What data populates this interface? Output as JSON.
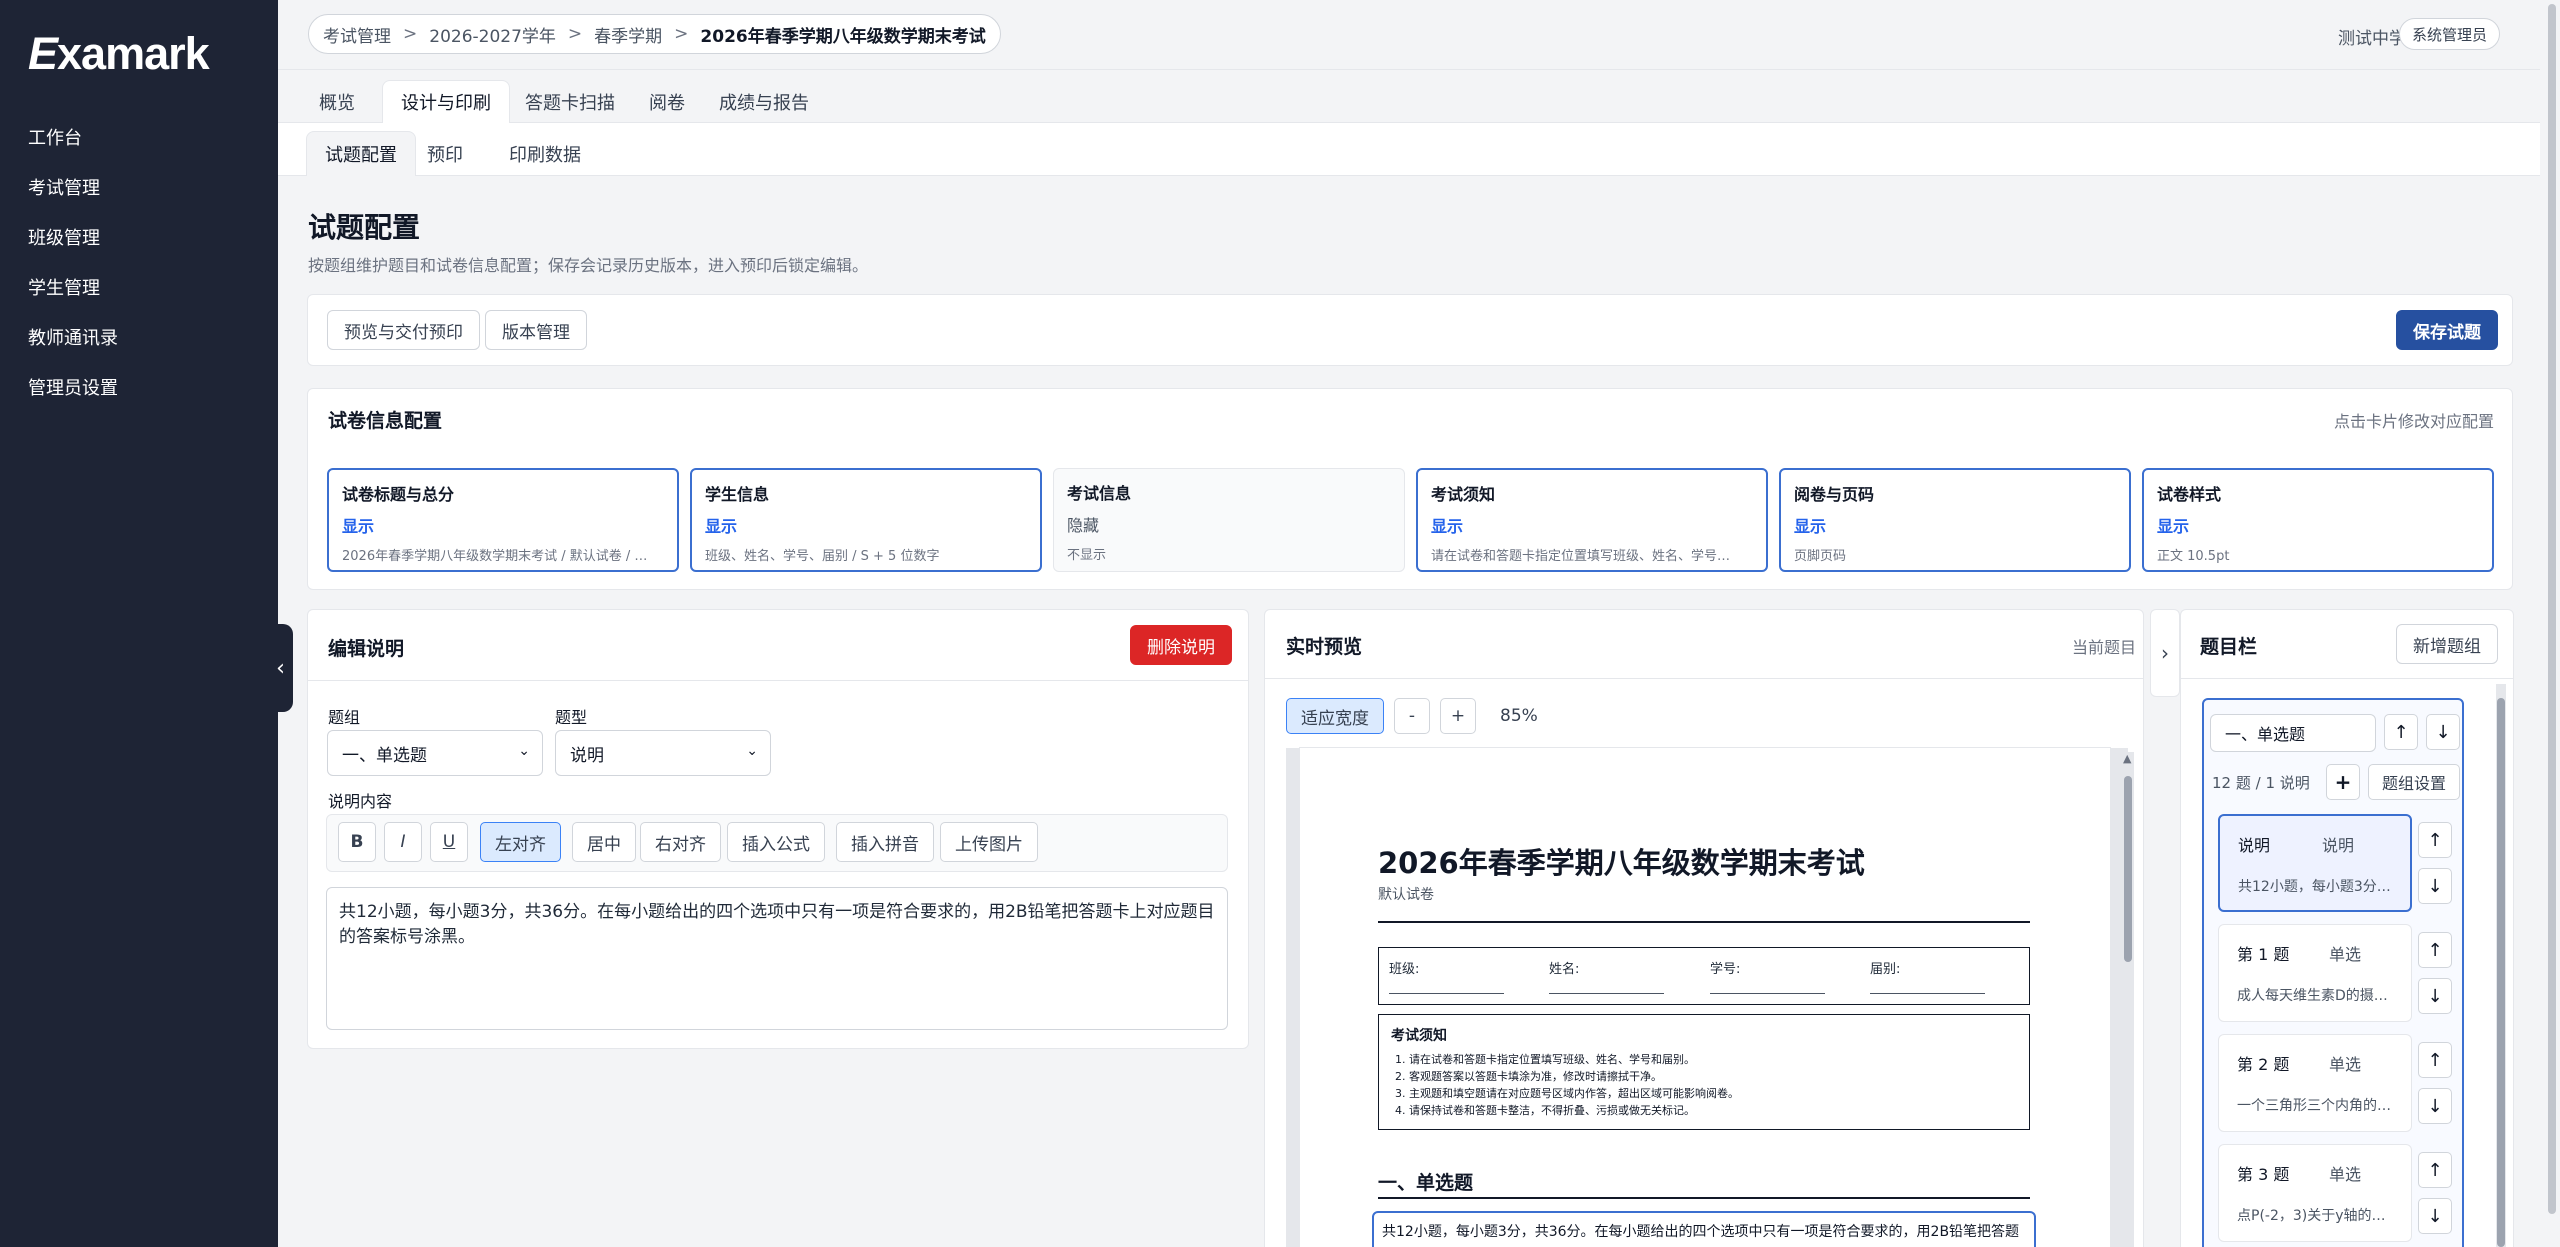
{
  "app": {
    "logo_prefix": "E",
    "logo_rest": "xamark"
  },
  "sidebar": {
    "items": [
      {
        "label": "工作台"
      },
      {
        "label": "考试管理"
      },
      {
        "label": "班级管理"
      },
      {
        "label": "学生管理"
      },
      {
        "label": "教师通讯录"
      },
      {
        "label": "管理员设置"
      }
    ]
  },
  "breadcrumb": [
    "考试管理",
    "2026-2027学年",
    "春季学期",
    "2026年春季学期八年级数学期末考试"
  ],
  "breadcrumb_sep": ">",
  "header": {
    "school": "测试中学",
    "role": "系统管理员"
  },
  "tabs": [
    "概览",
    "设计与印刷",
    "答题卡扫描",
    "阅卷",
    "成绩与报告"
  ],
  "subtabs": [
    "试题配置",
    "预印",
    "印刷数据"
  ],
  "page": {
    "title": "试题配置",
    "description": "按题组维护题目和试卷信息配置；保存会记录历史版本，进入预印后锁定编辑。"
  },
  "toolbar": {
    "preview_delivery": "预览与交付预印",
    "version_mgmt": "版本管理",
    "save": "保存试题"
  },
  "exam_info": {
    "title": "试卷信息配置",
    "hint": "点击卡片修改对应配置",
    "cards": [
      {
        "title": "试卷标题与总分",
        "status": "显示",
        "desc": "2026年春季学期八年级数学期末考试 / 默认试卷 / …"
      },
      {
        "title": "学生信息",
        "status": "显示",
        "desc": "班级、姓名、学号、届别 / S + 5 位数字"
      },
      {
        "title": "考试信息",
        "status": "隐藏",
        "desc": "不显示"
      },
      {
        "title": "考试须知",
        "status": "显示",
        "desc": "请在试卷和答题卡指定位置填写班级、姓名、学号…"
      },
      {
        "title": "阅卷与页码",
        "status": "显示",
        "desc": "页脚页码"
      },
      {
        "title": "试卷样式",
        "status": "显示",
        "desc": "正文 10.5pt"
      }
    ]
  },
  "edit_panel": {
    "title": "编辑说明",
    "delete_label": "删除说明",
    "group_label": "题组",
    "group_value": "一、单选题",
    "type_label": "题型",
    "type_value": "说明",
    "content_label": "说明内容",
    "format_buttons": [
      "B",
      "I",
      "U",
      "左对齐",
      "居中",
      "右对齐",
      "插入公式",
      "插入拼音",
      "上传图片"
    ],
    "content": "共12小题，每小题3分，共36分。在每小题给出的四个选项中只有一项是符合要求的，用2B铅笔把答题卡上对应题目的答案标号涂黑。"
  },
  "preview": {
    "title": "实时预览",
    "hint": "当前题目",
    "fit_width": "适应宽度",
    "zoom_out": "-",
    "zoom_in": "+",
    "zoom_level": "85%",
    "paper": {
      "title": "2026年春季学期八年级数学期末考试",
      "subtitle": "默认试卷",
      "fields": [
        "班级:",
        "姓名:",
        "学号:",
        "届别:"
      ],
      "notice_title": "考试须知",
      "notices": [
        "请在试卷和答题卡指定位置填写班级、姓名、学号和届别。",
        "客观题答案以答题卡填涂为准，修改时请擦拭干净。",
        "主观题和填空题请在对应题号区域内作答，超出区域可能影响阅卷。",
        "请保持试卷和答题卡整洁，不得折叠、污损或做无关标记。"
      ],
      "section_title": "一、单选题",
      "section_desc": "共12小题，每小题3分，共36分。在每小题给出的四个选项中只有一项是符合要求的，用2B铅笔把答题"
    }
  },
  "question_panel": {
    "title": "题目栏",
    "add_group": "新增题组",
    "group_name": "一、单选题",
    "group_count": "12 题 / 1 说明",
    "group_settings": "题组设置",
    "add_symbol": "+",
    "up_symbol": "↑",
    "down_symbol": "↓",
    "items": [
      {
        "head": "说明",
        "type": "说明",
        "desc": "共12小题，每小题3分…"
      },
      {
        "head": "第 1 题",
        "type": "单选",
        "desc": "成人每天维生素D的摄…"
      },
      {
        "head": "第 2 题",
        "type": "单选",
        "desc": "一个三角形三个内角的…"
      },
      {
        "head": "第 3 题",
        "type": "单选",
        "desc": "点P(-2，3)关于y轴的…"
      }
    ]
  },
  "colors": {
    "sidebar": "#1e2435",
    "accent": "#2650a0",
    "danger": "#dc2626",
    "card_border_active": "#3b6fd0"
  }
}
